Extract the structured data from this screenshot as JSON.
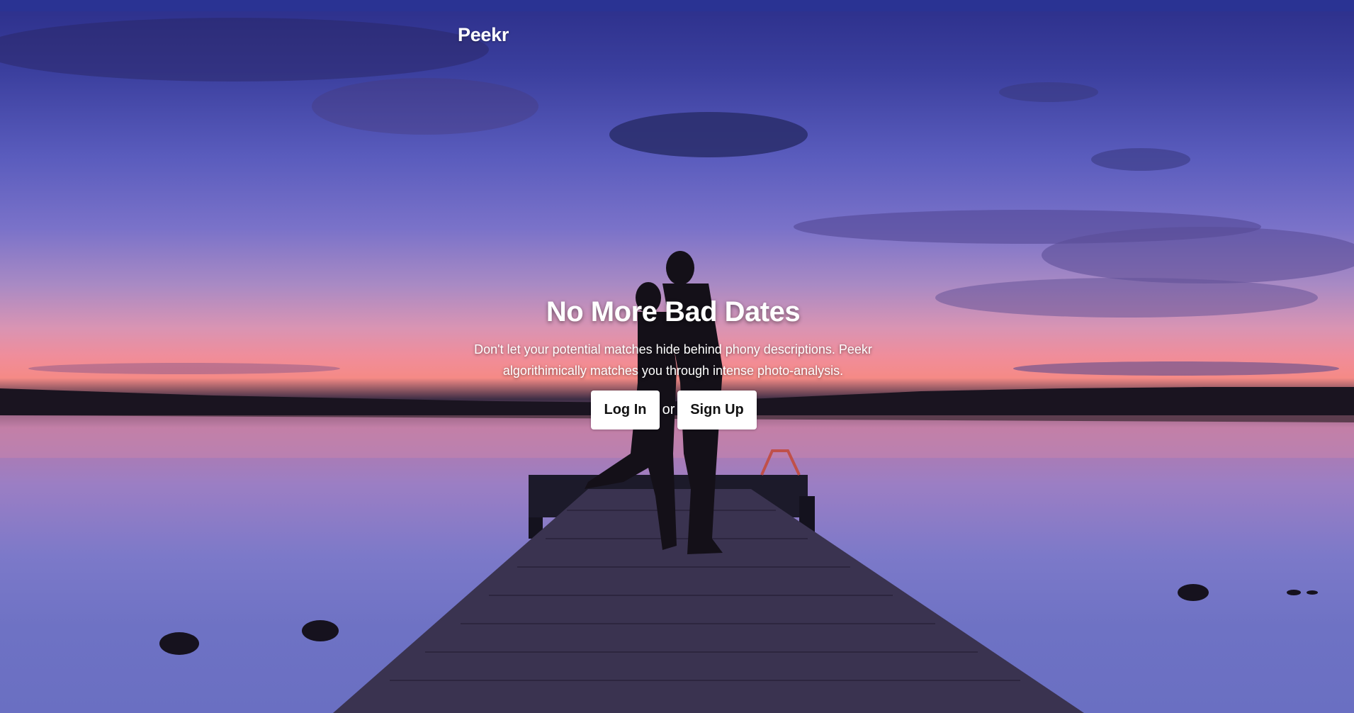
{
  "brand": {
    "name": "Peekr"
  },
  "hero": {
    "headline": "No More Bad Dates",
    "tagline": "Don't let your potential matches hide behind phony descriptions. Peekr algorithimically matches you through intense photo-analysis.",
    "or_text": "or"
  },
  "actions": {
    "login_label": "Log In",
    "signup_label": "Sign Up"
  },
  "colors": {
    "sky_top": "#2c2f8a",
    "sunset_glow": "#f58a86",
    "button_bg": "#ffffff",
    "button_text": "#111111"
  }
}
